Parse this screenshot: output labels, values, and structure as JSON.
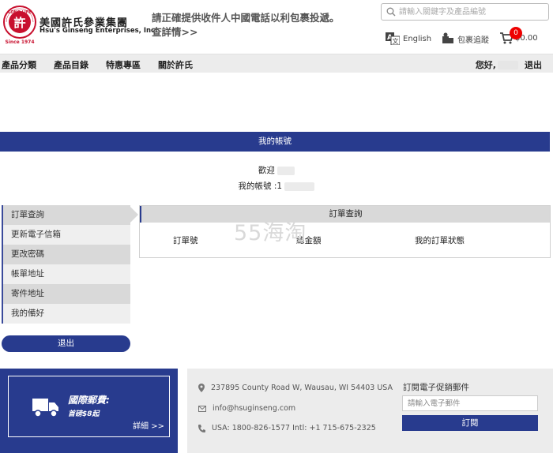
{
  "brand": {
    "logo_top": "LONG LIFE",
    "logo_char": "許",
    "logo_bottom": "Since 1974",
    "name_cn": "美國許氏參業集團",
    "name_en": "Hsu's Ginseng Enterprises, Inc."
  },
  "notice": {
    "text": "請正確提供收件人中國電話以利包裹投遞。",
    "more": "查詳情>>"
  },
  "search": {
    "placeholder": "請輸入關鍵字及產品編號"
  },
  "header_links": {
    "language": "English",
    "track": "包裹追蹤",
    "cart_total": "$0.00",
    "cart_count": "0"
  },
  "nav": {
    "items": [
      "產品分類",
      "產品目錄",
      "特惠專區",
      "關於許氏"
    ],
    "greeting": "您好,",
    "logout": "退出"
  },
  "account": {
    "title": "我的帳號",
    "welcome_label": "歡迎",
    "account_label": "我的帳號 :1"
  },
  "sidebar": {
    "items": [
      "訂單查詢",
      "更新電子信箱",
      "更改密碼",
      "帳單地址",
      "寄件地址",
      "我的備好"
    ],
    "logout": "退出"
  },
  "orders": {
    "title": "訂單查詢",
    "columns": [
      "訂單號",
      "總金額",
      "我的訂單狀態"
    ]
  },
  "watermark": "55海淘",
  "footer": {
    "ship_title": "國際郵費:",
    "ship_sub": "首磅$8起",
    "ship_more": "詳細 >>",
    "address": "237895 County Road W, Wausau, WI 54403 USA",
    "email": "info@hsuginseng.com",
    "phone": "USA: 1800-826-1577 Intl: +1 715-675-2325",
    "subscribe_title": "訂閱電子促銷郵件",
    "subscribe_placeholder": "請輸入電子郵件",
    "subscribe_button": "訂閱"
  },
  "colors": {
    "primary": "#283b8e",
    "badge": "#e00000",
    "panel": "#d9d9d9"
  }
}
